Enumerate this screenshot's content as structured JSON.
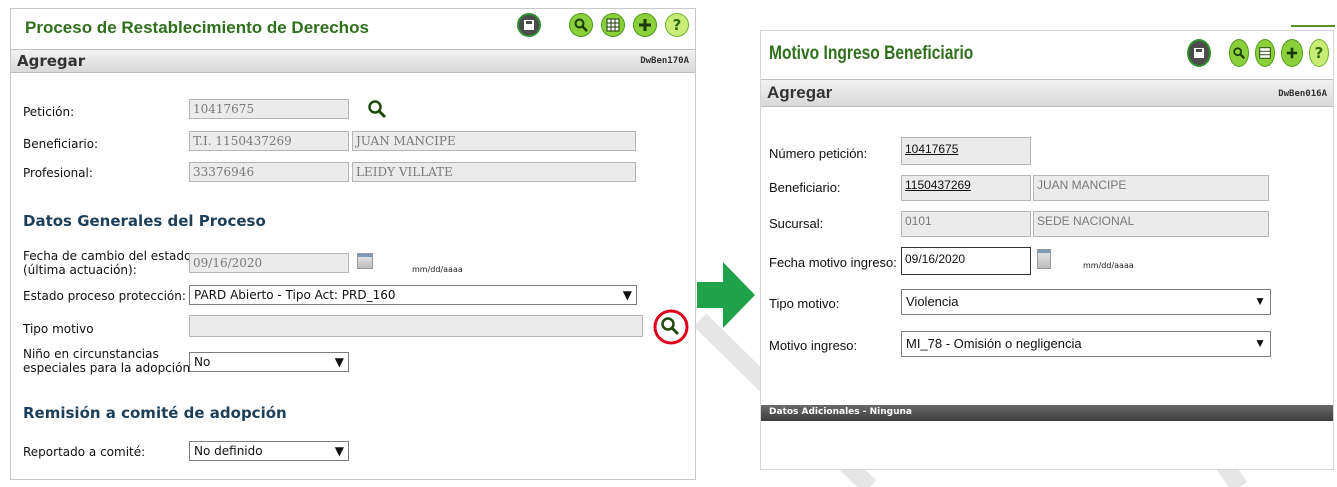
{
  "left": {
    "title": "Proceso de Restablecimiento de Derechos",
    "subheader": "Agregar",
    "code": "DwBen170A",
    "fields": {
      "peticion_label": "Petición:",
      "peticion_value": "10417675",
      "beneficiario_label": "Beneficiario:",
      "beneficiario_doc": "T.I. 1150437269",
      "beneficiario_name": "JUAN MANCIPE",
      "profesional_label": "Profesional:",
      "profesional_doc": "33376946",
      "profesional_name": "LEIDY VILLATE"
    },
    "section1": "Datos Generales del Proceso",
    "fecha_label_1": "Fecha de cambio del estado",
    "fecha_label_2": "(última actuación):",
    "fecha_value": "09/16/2020",
    "fecha_format": "mm/dd/aaaa",
    "estado_label": "Estado proceso protección:",
    "estado_value": "PARD Abierto - Tipo Act: PRD_160",
    "tipo_motivo_label": "Tipo motivo",
    "nino_label_1": "Niño en circunstancias",
    "nino_label_2": "especiales para la adopción",
    "nino_value": "No",
    "section2": "Remisión a comité de adopción",
    "reportado_label": "Reportado a comité:",
    "reportado_value": "No definido"
  },
  "right": {
    "title": "Motivo Ingreso Beneficiario",
    "subheader": "Agregar",
    "code": "DwBen016A",
    "numero_label": "Número petición:",
    "numero_value": "10417675",
    "beneficiario_label": "Beneficiario:",
    "beneficiario_doc": "1150437269",
    "beneficiario_name": "JUAN MANCIPE",
    "sucursal_label": "Sucursal:",
    "sucursal_code": "0101",
    "sucursal_name": "SEDE NACIONAL",
    "fecha_label": "Fecha motivo ingreso:",
    "fecha_value": "09/16/2020",
    "fecha_format": "mm/dd/aaaa",
    "tipo_label": "Tipo motivo:",
    "tipo_value": "Violencia",
    "motivo_label": "Motivo ingreso:",
    "motivo_value": "MI_78 - Omisión o negligencia",
    "adicionales": "Datos Adicionales - Ninguna"
  },
  "icons": [
    "save-icon",
    "search-icon",
    "calendar-list-icon",
    "add-icon",
    "help-icon"
  ],
  "colors": {
    "title_green": "#2f6f1c",
    "section_blue": "#1d3f5a",
    "arrow_green": "#1fa24a",
    "highlight_red": "#e0001a"
  }
}
